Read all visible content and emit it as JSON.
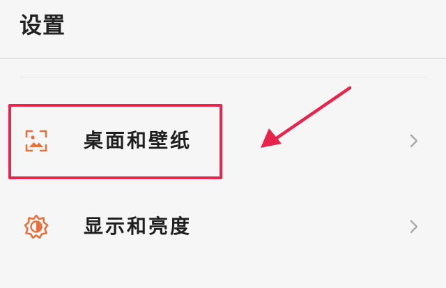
{
  "header": {
    "title": "设置"
  },
  "settings_items": [
    {
      "label": "桌面和壁纸",
      "icon": "wallpaper-icon",
      "chevron_icon": "chevron-right-icon"
    },
    {
      "label": "显示和亮度",
      "icon": "brightness-icon",
      "chevron_icon": "chevron-right-icon"
    }
  ],
  "colors": {
    "icon_accent": "#e8703a",
    "annotation_red": "#e8244c",
    "background": "#f6f6f6",
    "text_primary": "#1f1f1f",
    "chevron": "#a8a8a8"
  }
}
